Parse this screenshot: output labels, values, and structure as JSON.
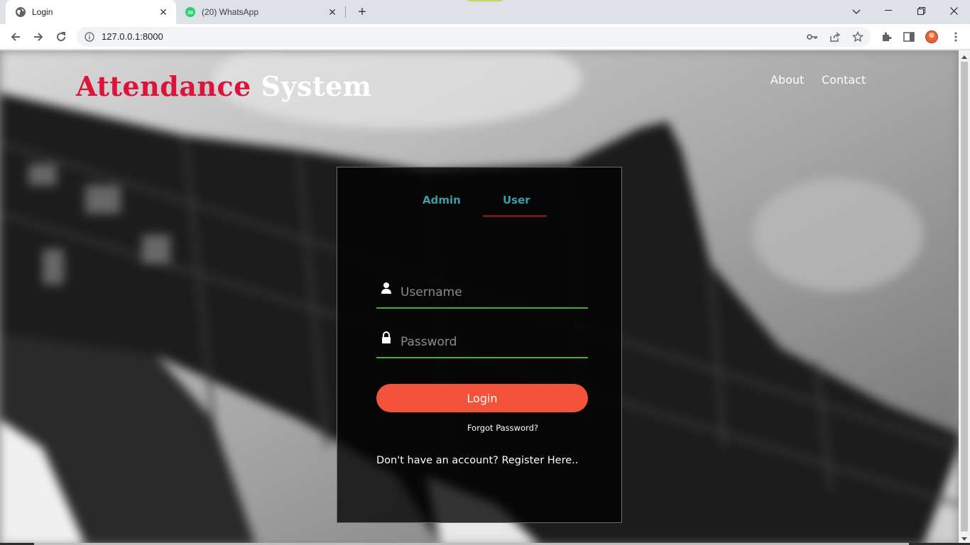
{
  "browser": {
    "tabs": [
      {
        "title": "Login",
        "active": true,
        "favicon": "globe-icon"
      },
      {
        "title": "(20) WhatsApp",
        "active": false,
        "favicon": "whatsapp-icon",
        "badge": "20"
      }
    ],
    "url": "127.0.0.1:8000",
    "accent_color": "#c5d56a"
  },
  "site": {
    "brand_word1": "Attendance",
    "brand_word2": "System",
    "brand_word1_color": "#dc143c",
    "nav": [
      {
        "label": "About"
      },
      {
        "label": "Contact"
      }
    ]
  },
  "login": {
    "role_tabs": [
      {
        "label": "Admin",
        "active": false
      },
      {
        "label": "User",
        "active": true
      }
    ],
    "username_placeholder": "Username",
    "username_value": "",
    "password_placeholder": "Password",
    "password_value": "",
    "login_label": "Login",
    "forgot_label": "Forgot Password?",
    "register_label": "Don't have an account? Register Here..",
    "button_color": "#f4523b",
    "field_underline_color": "#3bb03b",
    "tab_text_color": "#3a9ea2"
  }
}
